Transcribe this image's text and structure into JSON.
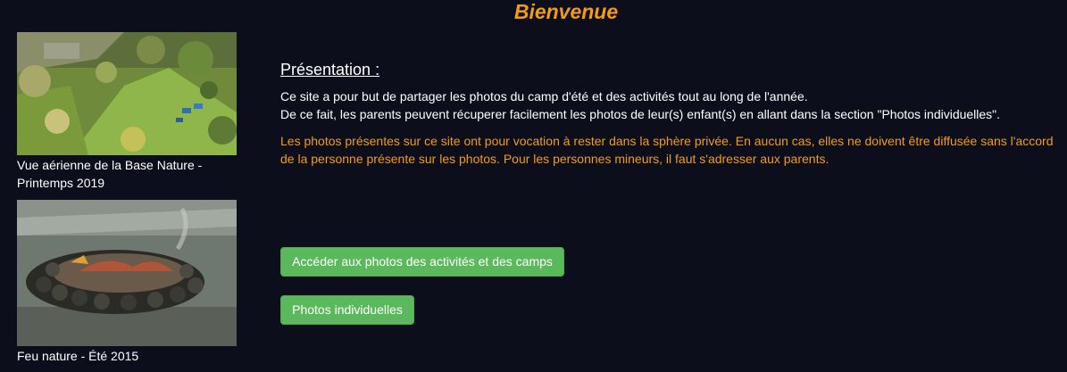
{
  "page": {
    "title": "Bienvenue"
  },
  "gallery": {
    "items": [
      {
        "caption": "Vue aérienne de la Base Nature - Printemps 2019",
        "image": "aerial-meadow-photo"
      },
      {
        "caption": "Feu nature - Été 2015",
        "image": "campfire-river-photo"
      }
    ]
  },
  "presentation": {
    "heading": "Présentation :",
    "line1": "Ce site a pour but de partager les photos du camp d'été et des activités tout au long de l'année.",
    "line2": "De ce fait, les parents peuvent récuperer facilement les photos de leur(s) enfant(s) en allant dans la section \"Photos individuelles\".",
    "warning": "Les photos présentes sur ce site ont pour vocation à rester dans la sphère privée. En aucun cas, elles ne doivent être diffusée sans l'accord de la personne présente sur les photos. Pour les personnes mineurs, il faut s'adresser aux parents."
  },
  "actions": {
    "activities_label": "Accéder aux photos des activités et des camps",
    "individual_label": "Photos individuelles"
  },
  "colors": {
    "background": "#0d0e1c",
    "accent": "#f39c12",
    "button": "#5cb85c"
  }
}
